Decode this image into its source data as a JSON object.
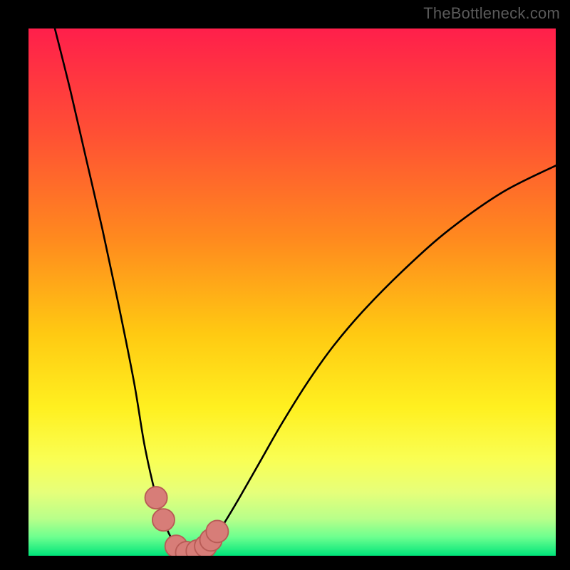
{
  "watermark": {
    "text": "TheBottleneck.com"
  },
  "colors": {
    "black": "#000000",
    "curve": "#000000",
    "marker_fill": "#d77d78",
    "marker_stroke": "#b85b56",
    "gradient_stops": [
      {
        "offset": 0.0,
        "color": "#ff1f4b"
      },
      {
        "offset": 0.2,
        "color": "#ff5034"
      },
      {
        "offset": 0.4,
        "color": "#ff8a1e"
      },
      {
        "offset": 0.58,
        "color": "#ffca12"
      },
      {
        "offset": 0.72,
        "color": "#fff020"
      },
      {
        "offset": 0.82,
        "color": "#f9ff55"
      },
      {
        "offset": 0.88,
        "color": "#e6ff7a"
      },
      {
        "offset": 0.93,
        "color": "#b8ff8a"
      },
      {
        "offset": 0.965,
        "color": "#6cff8f"
      },
      {
        "offset": 1.0,
        "color": "#00e47a"
      }
    ]
  },
  "chart_data": {
    "type": "line",
    "title": "",
    "xlabel": "",
    "ylabel": "",
    "xlim": [
      0,
      100
    ],
    "ylim": [
      0,
      100
    ],
    "series": [
      {
        "name": "bottleneck-curve",
        "x": [
          5,
          8,
          11,
          14,
          17,
          20,
          22,
          24,
          25.5,
          27,
          28.5,
          30,
          31.5,
          33,
          35,
          37,
          40,
          44,
          48,
          53,
          58,
          64,
          72,
          80,
          90,
          100
        ],
        "y": [
          100,
          88,
          75,
          62,
          48,
          33,
          21,
          12,
          7,
          3.5,
          1.5,
          0.6,
          0.6,
          1.2,
          3,
          6,
          11,
          18,
          25,
          33,
          40,
          47,
          55,
          62,
          69,
          74
        ]
      }
    ],
    "markers": {
      "name": "highlighted-points",
      "x": [
        24.2,
        25.6,
        28.0,
        30.0,
        32.0,
        33.6,
        34.6,
        35.8
      ],
      "y": [
        11.0,
        6.8,
        1.8,
        0.6,
        0.9,
        1.8,
        3.0,
        4.6
      ],
      "r": 2.1
    }
  }
}
